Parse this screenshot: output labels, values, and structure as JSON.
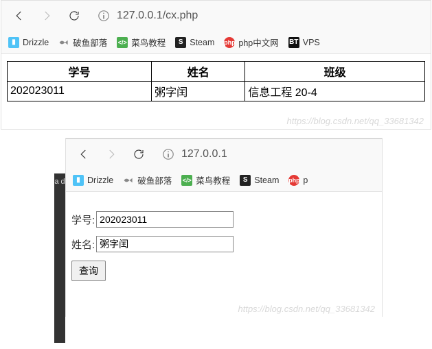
{
  "window1": {
    "url": "127.0.0.1/cx.php",
    "bookmarks": [
      {
        "label": "Drizzle"
      },
      {
        "label": "破鱼部落"
      },
      {
        "label": "菜鸟教程"
      },
      {
        "label": "Steam"
      },
      {
        "label": "php中文网"
      },
      {
        "label": "VPS"
      }
    ],
    "table": {
      "headers": [
        "学号",
        "姓名",
        "班级"
      ],
      "row": [
        "202023011",
        "粥字闰",
        "信息工程 20-4"
      ]
    },
    "watermark": "https://blog.csdn.net/qq_33681342"
  },
  "window2": {
    "url": "127.0.0.1",
    "bookmarks": [
      {
        "label": "Drizzle"
      },
      {
        "label": "破鱼部落"
      },
      {
        "label": "菜鸟教程"
      },
      {
        "label": "Steam"
      },
      {
        "label": "p"
      }
    ],
    "form": {
      "id_label": "学号:",
      "id_value": "202023011",
      "name_label": "姓名:",
      "name_value": "粥字闰",
      "submit_label": "查询"
    },
    "watermark": "https://blog.csdn.net/qq_33681342"
  },
  "sliver": "a\nd"
}
